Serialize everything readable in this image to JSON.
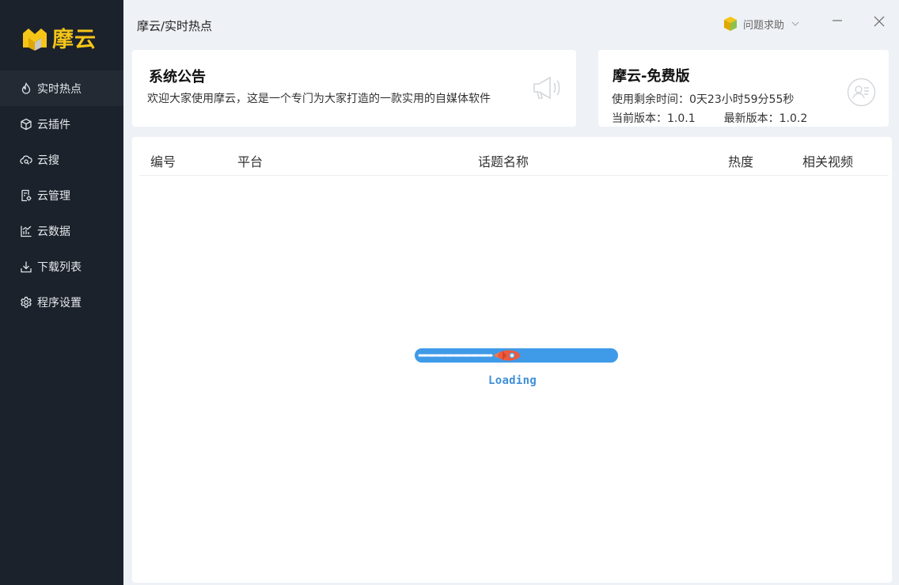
{
  "app": {
    "logo_text": "摩云",
    "brand_color": "#f5c518",
    "sidebar_bg": "#1c222b"
  },
  "sidebar": {
    "items": [
      {
        "label": "实时热点",
        "icon": "flame-icon",
        "active": true
      },
      {
        "label": "云插件",
        "icon": "cube-icon"
      },
      {
        "label": "云搜",
        "icon": "cloud-search-icon"
      },
      {
        "label": "云管理",
        "icon": "manage-doc-icon"
      },
      {
        "label": "云数据",
        "icon": "chart-icon"
      },
      {
        "label": "下载列表",
        "icon": "download-icon"
      },
      {
        "label": "程序设置",
        "icon": "gear-icon"
      }
    ]
  },
  "header": {
    "breadcrumb": "摩云/实时热点",
    "help_label": "问题求助"
  },
  "notice": {
    "title": "系统公告",
    "text": "欢迎大家使用摩云，这是一个专门为大家打造的一款实用的自媒体软件"
  },
  "version": {
    "title": "摩云-免费版",
    "remaining": "使用剩余时间：0天23小时59分55秒",
    "current": "当前版本：1.0.1",
    "latest": "最新版本：1.0.2"
  },
  "table": {
    "columns": [
      "编号",
      "平台",
      "话题名称",
      "热度",
      "相关视频"
    ],
    "rows": []
  },
  "loading": {
    "text": "Loading",
    "color": "#3f9ae8"
  }
}
